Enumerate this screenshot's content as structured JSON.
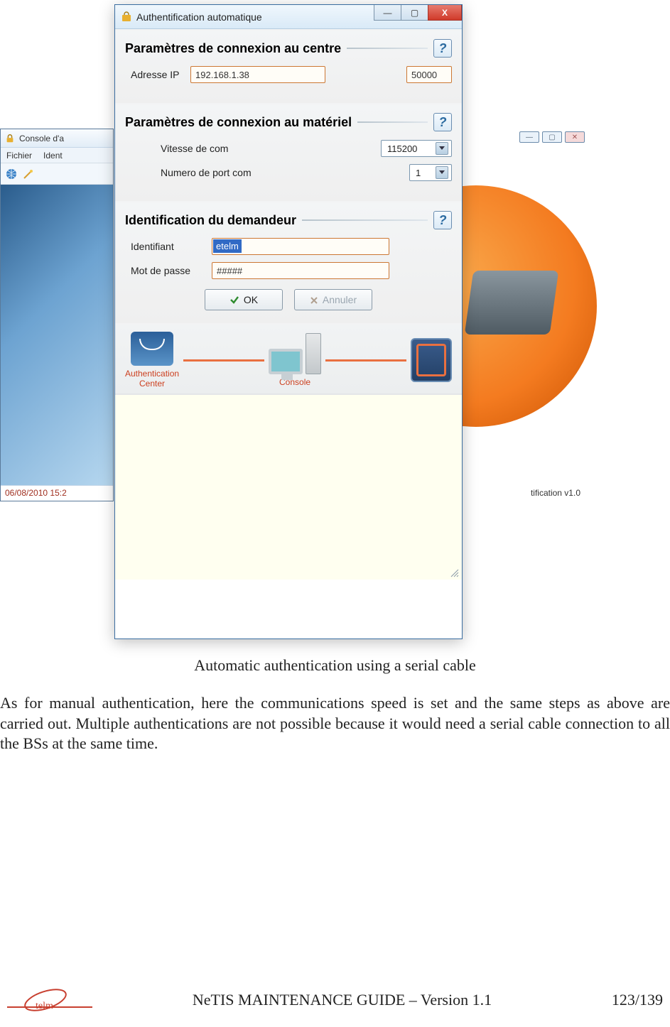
{
  "console_window": {
    "title": "Console d'a",
    "menu": [
      "Fichier",
      "Ident"
    ],
    "status_left": "06/08/2010 15:2",
    "status_right": "tification v1.0",
    "win_buttons": {
      "min": "—",
      "max": "▢",
      "close": "✕"
    }
  },
  "dialog": {
    "title": "Authentification automatique",
    "win_buttons": {
      "min": "—",
      "max": "▢",
      "close": "X"
    },
    "section_centre": {
      "heading": "Paramètres de connexion au centre",
      "ip_label": "Adresse IP",
      "ip_value": "192.168.1.38",
      "port_value": "50000"
    },
    "section_materiel": {
      "heading": "Paramètres de connexion au matériel",
      "speed_label": "Vitesse de com",
      "speed_value": "115200",
      "port_label": "Numero de port com",
      "port_value": "1"
    },
    "section_id": {
      "heading": "Identification du demandeur",
      "id_label": "Identifiant",
      "id_value": "etelm",
      "pwd_label": "Mot de passe",
      "pwd_value": "#####"
    },
    "buttons": {
      "ok": "OK",
      "cancel": "Annuler"
    },
    "diagram": {
      "auth_label_1": "Authentication",
      "auth_label_2": "Center",
      "console_label": "Console"
    }
  },
  "caption": "Automatic authentication using a serial cable",
  "paragraph": "As for manual authentication, here the communications speed is set and the same steps as above are carried out. Multiple authentications are not possible because it would need a serial cable connection to all the BSs at the same time.",
  "footer": {
    "title": "NeTIS MAINTENANCE GUIDE – Version 1.1",
    "page": "123/139",
    "logo_text": "telm"
  }
}
